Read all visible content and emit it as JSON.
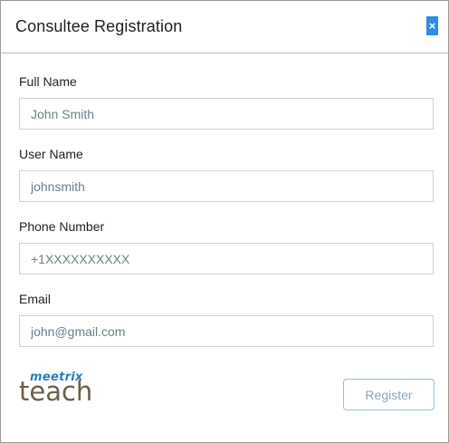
{
  "dialog": {
    "title": "Consultee Registration",
    "close_glyph": "×"
  },
  "form": {
    "full_name": {
      "label": "Full Name",
      "value": "John Smith"
    },
    "user_name": {
      "label": "User Name",
      "value": "johnsmith"
    },
    "phone": {
      "label": "Phone Number",
      "value": "+1XXXXXXXXXX"
    },
    "email": {
      "label": "Email",
      "value": "john@gmail.com"
    }
  },
  "logo": {
    "top_text": "meetrix",
    "main_text": "teach"
  },
  "actions": {
    "register_label": "Register"
  },
  "colors": {
    "close_button_bg": "#2e8be6",
    "logo_top": "#2a7cc4",
    "logo_main": "#6b5f48",
    "register_border": "#8fc0e6"
  },
  "icons": {
    "close": "close-icon"
  }
}
